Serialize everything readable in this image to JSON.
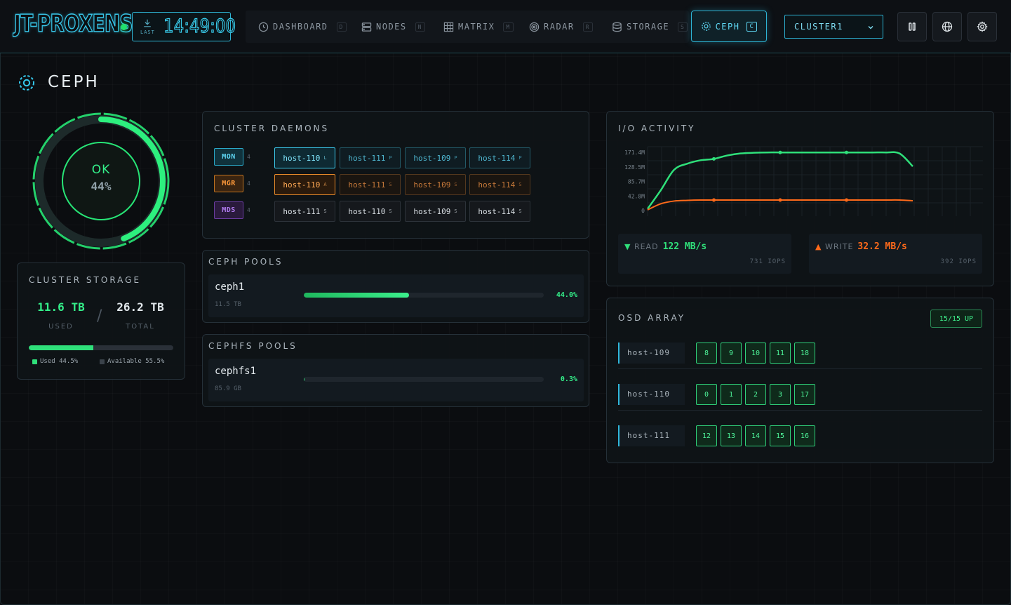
{
  "app": {
    "logo": "JT-PROXENSE",
    "clock_label": "LAST",
    "clock_time": "14:49:00"
  },
  "nav": {
    "items": [
      {
        "label": "DASHBOARD",
        "key": "D"
      },
      {
        "label": "NODES",
        "key": "N"
      },
      {
        "label": "MATRIX",
        "key": "M"
      },
      {
        "label": "RADAR",
        "key": "R"
      },
      {
        "label": "STORAGE",
        "key": "S"
      },
      {
        "label": "CEPH",
        "key": "C"
      }
    ],
    "cluster_select": "CLUSTER1"
  },
  "page": {
    "title": "CEPH"
  },
  "health": {
    "status": "OK",
    "percent": "44%",
    "fill_fraction": 0.44
  },
  "storage": {
    "title": "CLUSTER STORAGE",
    "used": "11.6 TB",
    "total": "26.2 TB",
    "used_label": "USED",
    "total_label": "TOTAL",
    "used_fraction": 0.445,
    "legend_used": "Used 44.5%",
    "legend_available": "Available 55.5%"
  },
  "daemons": {
    "title": "CLUSTER DAEMONS",
    "rows": [
      {
        "role": "MON",
        "count": "4",
        "hosts": [
          {
            "name": "host-110",
            "state": "L"
          },
          {
            "name": "host-111",
            "state": "P"
          },
          {
            "name": "host-109",
            "state": "P"
          },
          {
            "name": "host-114",
            "state": "P"
          }
        ]
      },
      {
        "role": "MGR",
        "count": "4",
        "hosts": [
          {
            "name": "host-110",
            "state": "A"
          },
          {
            "name": "host-111",
            "state": "S"
          },
          {
            "name": "host-109",
            "state": "S"
          },
          {
            "name": "host-114",
            "state": "S"
          }
        ]
      },
      {
        "role": "MDS",
        "count": "4",
        "hosts": [
          {
            "name": "host-111",
            "state": "S"
          },
          {
            "name": "host-110",
            "state": "S"
          },
          {
            "name": "host-109",
            "state": "S"
          },
          {
            "name": "host-114",
            "state": "S"
          }
        ]
      }
    ]
  },
  "ceph_pools": {
    "title": "CEPH POOLS",
    "pools": [
      {
        "name": "ceph1",
        "size": "11.5 TB",
        "percent": "44.0%",
        "fraction": 0.44
      }
    ]
  },
  "cephfs_pools": {
    "title": "CEPHFS POOLS",
    "pools": [
      {
        "name": "cephfs1",
        "size": "85.9 GB",
        "percent": "0.3%",
        "fraction": 0.003
      }
    ]
  },
  "io": {
    "title": "I/O ACTIVITY",
    "read_label": "READ",
    "read_value": "122 MB/s",
    "read_iops": "731 IOPS",
    "write_label": "WRITE",
    "write_value": "32.2 MB/s",
    "write_iops": "392 IOPS",
    "read_color": "#2fe07a",
    "write_color": "#ff6a1a"
  },
  "chart_data": {
    "type": "line",
    "y_ticks": [
      "171.4M",
      "128.5M",
      "85.7M",
      "42.8M",
      "0"
    ],
    "ylim": [
      0,
      171.4
    ],
    "x": [
      0,
      1,
      2,
      3,
      4,
      5,
      6,
      7,
      8,
      9,
      10,
      11,
      12,
      13,
      14,
      15,
      16,
      17,
      18,
      19,
      20
    ],
    "series": [
      {
        "values": [
          5,
          60,
          120,
          138,
          148,
          152,
          162,
          168,
          170,
          171,
          171,
          171,
          171,
          171,
          171,
          171,
          171,
          171,
          171,
          168,
          130
        ]
      },
      {
        "values": [
          2,
          20,
          28,
          30,
          31,
          31,
          31,
          31,
          31,
          31,
          31,
          31,
          31,
          31,
          31,
          31,
          31,
          31,
          31,
          31,
          29
        ]
      }
    ],
    "markers": [
      5,
      10,
      15
    ],
    "grid": true,
    "xlabel": "",
    "ylabel": ""
  },
  "osd": {
    "title": "OSD ARRAY",
    "badge": "15/15 UP",
    "hosts": [
      {
        "name": "host-109",
        "osds": [
          "8",
          "9",
          "10",
          "11",
          "18"
        ]
      },
      {
        "name": "host-110",
        "osds": [
          "0",
          "1",
          "2",
          "3",
          "17"
        ]
      },
      {
        "name": "host-111",
        "osds": [
          "12",
          "13",
          "14",
          "15",
          "16"
        ]
      }
    ]
  }
}
